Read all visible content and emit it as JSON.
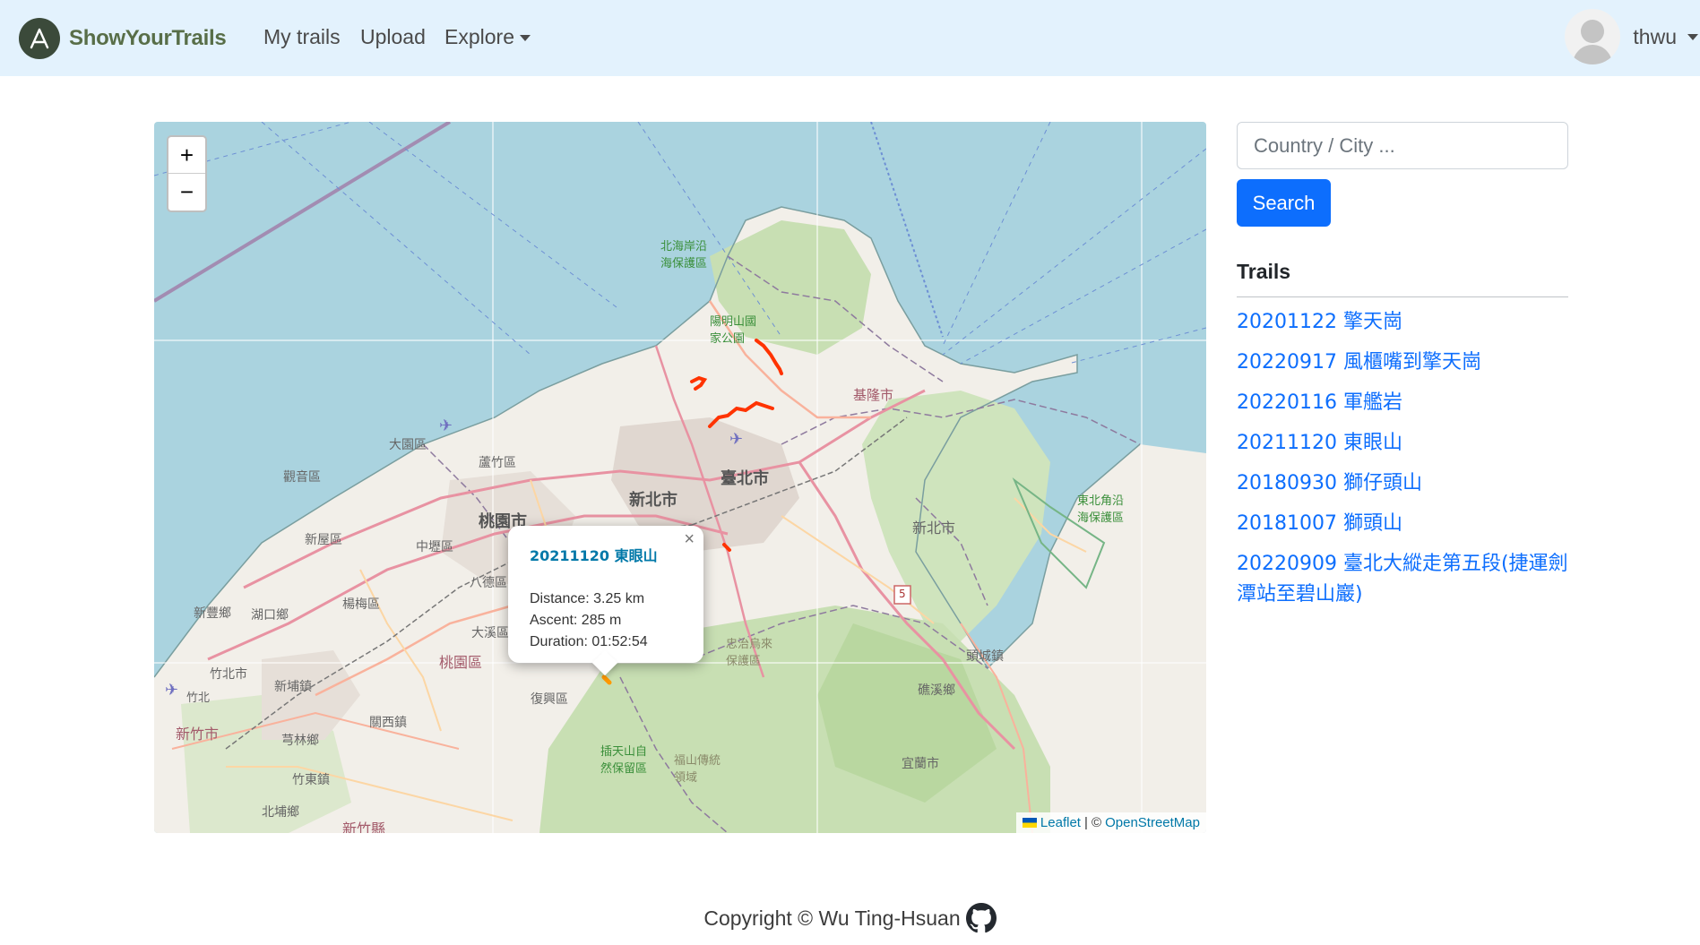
{
  "navbar": {
    "brand": "ShowYourTrails",
    "links": [
      "My trails",
      "Upload"
    ],
    "explore_label": "Explore",
    "user_name": "thwu"
  },
  "map": {
    "zoom_in": "+",
    "zoom_out": "−",
    "popup": {
      "title": "20211120 東眼山",
      "distance": "Distance: 3.25 km",
      "ascent": "Ascent: 285 m",
      "duration": "Duration: 01:52:54",
      "close": "×"
    },
    "attribution": {
      "leaflet": "Leaflet",
      "separator": "| ©",
      "osm": "OpenStreetMap"
    },
    "labels": {
      "taipei": "臺北市",
      "new_taipei": "新北市",
      "new_taipei_east": "新北市",
      "taoyuan": "桃園市",
      "keelung": "基隆市",
      "yangming": "陽明山國家公園",
      "north_coast": "北海岸沿海保護區",
      "ne_coast": "東北角沿海保護區",
      "dayuan": "大園區",
      "luzhu": "蘆竹區",
      "guanyin": "觀音區",
      "zhongli": "中壢區",
      "xinwu": "新屋區",
      "bade": "八德區",
      "yangmei": "楊梅區",
      "hukou": "湖口鄉",
      "xinfeng": "新豐鄉",
      "daxi": "大溪區",
      "taoyuan_dist": "桃園區",
      "zhubei": "竹北市",
      "xinpu": "新埔鎮",
      "guanxi": "關西鎮",
      "hsinchu": "新竹市",
      "qionglin": "芎林鄉",
      "zhudong": "竹東鎮",
      "beipu": "北埔鄉",
      "hsinchu_county": "新竹縣",
      "fuxing": "復興區",
      "toucheng": "頭城鎮",
      "jiaoxi": "礁溪鄉",
      "yilan": "宜蘭市",
      "wulai": "忠治烏來保護區",
      "sheng_an": "插天山自然保留區",
      "fushan": "福山傳統領域",
      "highway": "5",
      "airport_north": "竹北"
    },
    "icons": [
      "airport-icon"
    ]
  },
  "sidebar": {
    "search_placeholder": "Country / City ...",
    "search_button": "Search",
    "trails_heading": "Trails",
    "trails": [
      "20201122 擎天崗",
      "20220917 風櫃嘴到擎天崗",
      "20220116 軍艦岩",
      "20211120 東眼山",
      "20180930 獅仔頭山",
      "20181007 獅頭山",
      "20220909 臺北大縱走第五段(捷運劍潭站至碧山巖)"
    ]
  },
  "footer": {
    "copyright": "Copyright © Wu Ting-Hsuan"
  },
  "colors": {
    "navbar_bg": "#e3f2fd",
    "link_blue": "#0d6efd",
    "trail_red": "#ff3300",
    "sea": "#aad3df",
    "land": "#f2efe9",
    "forest": "#c8dfb3"
  }
}
